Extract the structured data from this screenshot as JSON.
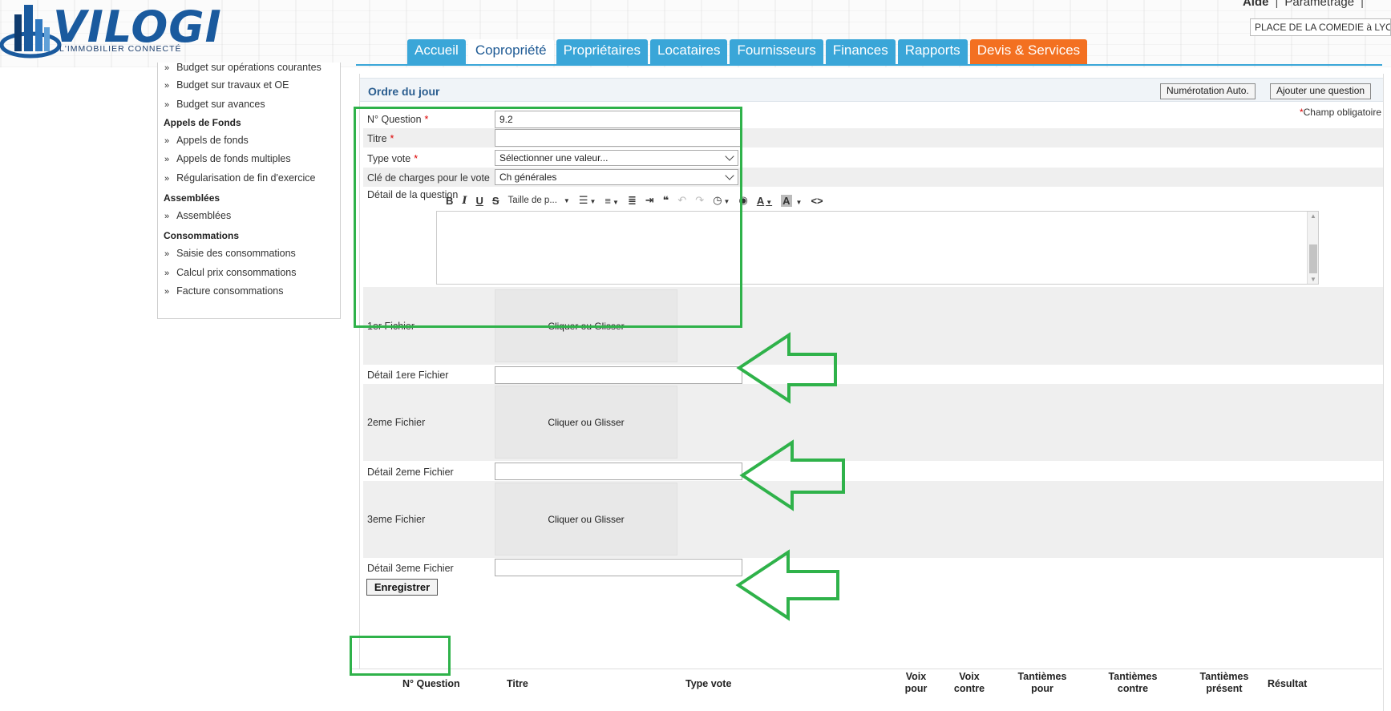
{
  "header": {
    "logo_text": "VILOGI",
    "logo_tagline": "L'IMMOBILIER CONNECTÉ",
    "top_links": [
      "Aide",
      "Paramétrage"
    ],
    "site_selector": "PLACE DE LA COMEDIE à LYON"
  },
  "nav": {
    "tabs": [
      {
        "label": "Accueil"
      },
      {
        "label": "Copropriété",
        "active": true
      },
      {
        "label": "Propriétaires"
      },
      {
        "label": "Locataires"
      },
      {
        "label": "Fournisseurs"
      },
      {
        "label": "Finances"
      },
      {
        "label": "Rapports"
      },
      {
        "label": "Devis & Services"
      }
    ]
  },
  "sidebar": {
    "budget_items": [
      "Budget sur opérations courantes",
      "Budget sur travaux et OE",
      "Budget sur avances"
    ],
    "sections": [
      {
        "title": "Appels de Fonds",
        "items": [
          "Appels de fonds",
          "Appels de fonds multiples",
          "Régularisation de fin d'exercice"
        ]
      },
      {
        "title": "Assemblées",
        "items": [
          "Assemblées"
        ]
      },
      {
        "title": "Consommations",
        "items": [
          "Saisie des consommations",
          "Calcul prix consommations",
          "Facture consommations"
        ]
      }
    ]
  },
  "panel": {
    "title": "Ordre du jour",
    "btn_auto_numbering": "Numérotation Auto.",
    "btn_add_question": "Ajouter une question",
    "required_note": "Champ obligatoire",
    "required_star": "*"
  },
  "form": {
    "question_no_label": "N° Question",
    "question_no_value": "9.2",
    "title_label": "Titre",
    "title_value": "",
    "vote_type_label": "Type vote",
    "vote_type_value": "Sélectionner une valeur...",
    "charge_key_label": "Clé de charges pour le vote",
    "charge_key_value": "Ch générales",
    "detail_label": "Détail de la question",
    "font_size_placeholder": "Taille de p...",
    "file1_label": "1er Fichier",
    "file1_detail_label": "Détail 1ere Fichier",
    "file2_label": "2eme Fichier",
    "file2_detail_label": "Détail 2eme Fichier",
    "file3_label": "3eme Fichier",
    "file3_detail_label": "Détail 3eme Fichier",
    "dropzone_text": "Cliquer ou Glisser",
    "save_label": "Enregistrer"
  },
  "table": {
    "columns": [
      "N° Question",
      "Titre",
      "Type vote",
      "Voix pour",
      "Voix contre",
      "Tantièmes pour",
      "Tantièmes contre",
      "Tantièmes présent",
      "Résultat"
    ]
  },
  "colors": {
    "tab_blue": "#3aa6d8",
    "tab_orange": "#f37021",
    "annotation_green": "#2fb24a",
    "required_red": "#dd0000"
  }
}
